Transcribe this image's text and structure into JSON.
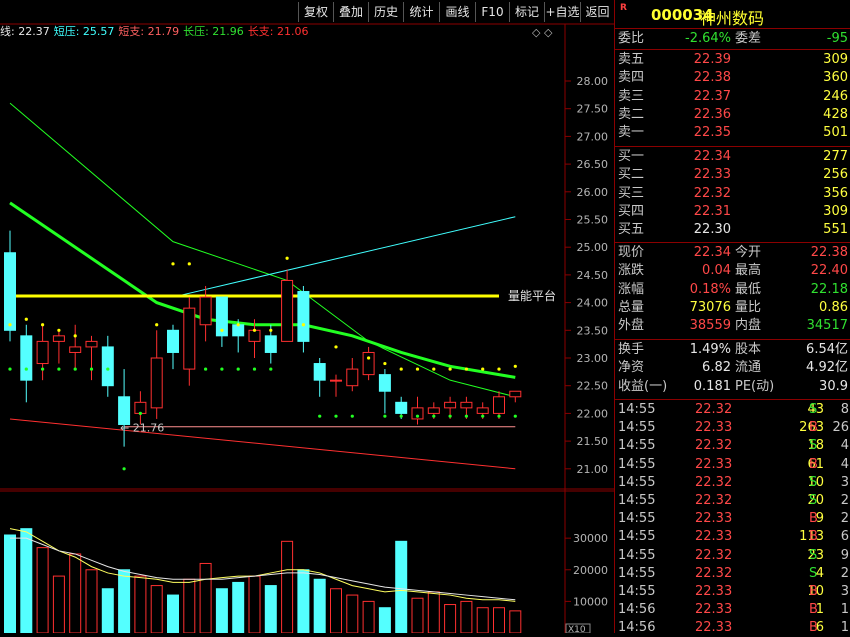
{
  "toolbar": {
    "buttons": [
      "复权",
      "叠加",
      "历史",
      "统计",
      "画线",
      "F10",
      "标记",
      "+自选",
      "返回"
    ]
  },
  "indicators": [
    {
      "label": "线:",
      "value": "22.37",
      "color": "#e6e6e6"
    },
    {
      "label": "短压:",
      "value": "25.57",
      "color": "#40ffff"
    },
    {
      "label": "短支:",
      "value": "21.79",
      "color": "#ff6060"
    },
    {
      "label": "长压:",
      "value": "21.96",
      "color": "#30e030"
    },
    {
      "label": "长支:",
      "value": "21.06",
      "color": "#ff3030"
    }
  ],
  "annotations": {
    "platform_label": "量能平台",
    "low_label": "21.76",
    "vol_unit": "X10",
    "top_marker": "◇ ◇"
  },
  "colors": {
    "up": "#ff3030",
    "down": "#54ffff",
    "ma_green": "#22ff22",
    "platform": "#ffff00",
    "axis": "#8b0000"
  },
  "chart_data": [
    {
      "type": "candlestick",
      "y_ticks": [
        "28.00",
        "27.50",
        "27.00",
        "26.50",
        "26.00",
        "25.50",
        "25.00",
        "24.50",
        "24.00",
        "23.50",
        "23.00",
        "22.50",
        "22.00",
        "21.50",
        "21.00"
      ],
      "ylim": [
        20.55,
        28.55
      ],
      "candles": [
        {
          "o": 24.9,
          "c": 23.5,
          "h": 25.3,
          "l": 23.3
        },
        {
          "o": 23.4,
          "c": 22.6,
          "h": 23.6,
          "l": 22.2
        },
        {
          "o": 22.9,
          "c": 23.3,
          "h": 23.6,
          "l": 22.6
        },
        {
          "o": 23.3,
          "c": 23.4,
          "h": 23.5,
          "l": 22.9
        },
        {
          "o": 23.1,
          "c": 23.2,
          "h": 23.6,
          "l": 22.8
        },
        {
          "o": 23.2,
          "c": 23.3,
          "h": 23.4,
          "l": 22.6
        },
        {
          "o": 23.2,
          "c": 22.5,
          "h": 23.4,
          "l": 22.3
        },
        {
          "o": 22.3,
          "c": 21.8,
          "h": 22.8,
          "l": 21.4
        },
        {
          "o": 22.0,
          "c": 22.2,
          "h": 22.4,
          "l": 21.8
        },
        {
          "o": 22.1,
          "c": 23.0,
          "h": 23.5,
          "l": 21.9
        },
        {
          "o": 23.5,
          "c": 23.1,
          "h": 23.6,
          "l": 22.8
        },
        {
          "o": 22.8,
          "c": 23.9,
          "h": 24.1,
          "l": 22.5
        },
        {
          "o": 23.6,
          "c": 24.1,
          "h": 24.3,
          "l": 23.3
        },
        {
          "o": 24.1,
          "c": 23.4,
          "h": 24.1,
          "l": 23.2
        },
        {
          "o": 23.6,
          "c": 23.4,
          "h": 23.7,
          "l": 23.1
        },
        {
          "o": 23.3,
          "c": 23.5,
          "h": 23.7,
          "l": 23.0
        },
        {
          "o": 23.4,
          "c": 23.1,
          "h": 23.6,
          "l": 22.9
        },
        {
          "o": 23.3,
          "c": 24.4,
          "h": 24.6,
          "l": 23.3
        },
        {
          "o": 24.2,
          "c": 23.3,
          "h": 24.3,
          "l": 23.1
        },
        {
          "o": 22.9,
          "c": 22.6,
          "h": 23.0,
          "l": 22.3
        },
        {
          "o": 22.6,
          "c": 22.6,
          "h": 22.7,
          "l": 22.3
        },
        {
          "o": 22.5,
          "c": 22.8,
          "h": 23.0,
          "l": 22.4
        },
        {
          "o": 22.7,
          "c": 23.1,
          "h": 23.2,
          "l": 22.6
        },
        {
          "o": 22.7,
          "c": 22.4,
          "h": 22.8,
          "l": 22.0
        },
        {
          "o": 22.2,
          "c": 22.0,
          "h": 22.3,
          "l": 21.9
        },
        {
          "o": 21.9,
          "c": 22.1,
          "h": 22.3,
          "l": 21.8
        },
        {
          "o": 22.0,
          "c": 22.1,
          "h": 22.2,
          "l": 21.9
        },
        {
          "o": 22.1,
          "c": 22.2,
          "h": 22.3,
          "l": 21.9
        },
        {
          "o": 22.1,
          "c": 22.2,
          "h": 22.3,
          "l": 21.9
        },
        {
          "o": 22.0,
          "c": 22.1,
          "h": 22.2,
          "l": 21.9
        },
        {
          "o": 22.0,
          "c": 22.3,
          "h": 22.4,
          "l": 21.9
        },
        {
          "o": 22.3,
          "c": 22.4,
          "h": 22.4,
          "l": 22.2
        }
      ],
      "lines": [
        {
          "name": "ma_green",
          "color": "#22ff22",
          "width": 3,
          "points": [
            [
              0,
              25.8
            ],
            [
              3,
              25.2
            ],
            [
              6,
              24.6
            ],
            [
              9,
              24.0
            ],
            [
              12,
              23.7
            ],
            [
              15,
              23.6
            ],
            [
              18,
              23.6
            ],
            [
              21,
              23.4
            ],
            [
              24,
              23.1
            ],
            [
              27,
              22.85
            ],
            [
              30,
              22.7
            ],
            [
              31,
              22.65
            ]
          ]
        },
        {
          "name": "ma_thin_green",
          "color": "#22ff22",
          "width": 1,
          "points": [
            [
              0,
              27.6
            ],
            [
              10,
              25.1
            ],
            [
              17,
              24.4
            ],
            [
              22,
              23.3
            ],
            [
              27,
              22.6
            ],
            [
              31,
              22.3
            ]
          ]
        },
        {
          "name": "cyan_trend",
          "color": "#40ffff",
          "width": 1,
          "points": [
            [
              10,
              24.1
            ],
            [
              31,
              25.55
            ]
          ]
        },
        {
          "name": "red_trend",
          "color": "#ff3030",
          "width": 1,
          "points": [
            [
              0,
              21.9
            ],
            [
              31,
              21.0
            ]
          ]
        },
        {
          "name": "pink_flat",
          "color": "#ff9090",
          "width": 1,
          "points": [
            [
              7,
              21.76
            ],
            [
              31,
              21.76
            ]
          ]
        },
        {
          "name": "platform",
          "color": "#ffff00",
          "width": 3,
          "points": [
            [
              0,
              24.12
            ],
            [
              30,
              24.12
            ]
          ]
        }
      ],
      "dots_yellow": [
        [
          0,
          23.6
        ],
        [
          1,
          23.7
        ],
        [
          2,
          23.6
        ],
        [
          3,
          23.5
        ],
        [
          4,
          23.4
        ],
        [
          9,
          23.6
        ],
        [
          10,
          24.7
        ],
        [
          11,
          24.7
        ],
        [
          13,
          23.5
        ],
        [
          14,
          23.6
        ],
        [
          15,
          23.5
        ],
        [
          16,
          23.5
        ],
        [
          17,
          24.8
        ],
        [
          18,
          23.6
        ],
        [
          20,
          23.2
        ],
        [
          22,
          23.0
        ],
        [
          23,
          22.9
        ],
        [
          24,
          22.8
        ],
        [
          25,
          22.8
        ],
        [
          26,
          22.8
        ],
        [
          27,
          22.8
        ],
        [
          28,
          22.8
        ],
        [
          29,
          22.8
        ],
        [
          30,
          22.8
        ],
        [
          31,
          22.85
        ]
      ],
      "dots_green": [
        [
          0,
          22.8
        ],
        [
          1,
          22.8
        ],
        [
          2,
          22.8
        ],
        [
          3,
          22.8
        ],
        [
          4,
          22.8
        ],
        [
          5,
          22.8
        ],
        [
          6,
          22.8
        ],
        [
          7,
          21.0
        ],
        [
          8,
          22.0
        ],
        [
          12,
          22.8
        ],
        [
          13,
          22.8
        ],
        [
          14,
          22.8
        ],
        [
          15,
          22.8
        ],
        [
          16,
          22.8
        ],
        [
          19,
          21.95
        ],
        [
          20,
          21.95
        ],
        [
          21,
          21.95
        ],
        [
          23,
          21.95
        ],
        [
          24,
          21.95
        ],
        [
          25,
          21.95
        ],
        [
          26,
          21.95
        ],
        [
          27,
          21.95
        ],
        [
          28,
          21.95
        ],
        [
          29,
          21.95
        ],
        [
          30,
          21.95
        ],
        [
          31,
          21.95
        ]
      ]
    },
    {
      "type": "volume",
      "y_ticks": [
        "30000",
        "20000",
        "10000"
      ],
      "ylim": [
        0,
        35000
      ],
      "values": [
        31000,
        33000,
        27000,
        18000,
        25000,
        20000,
        14000,
        20000,
        18000,
        15000,
        12000,
        17000,
        22000,
        14000,
        16000,
        18000,
        15000,
        29000,
        20000,
        17000,
        14000,
        12000,
        10000,
        8000,
        29000,
        11000,
        13000,
        9000,
        10000,
        8000,
        8000,
        7000
      ],
      "ma_yellow": [
        33000,
        32000,
        29000,
        26000,
        24000,
        21000,
        19000,
        18000,
        17500,
        17000,
        16000,
        16000,
        17000,
        17500,
        18000,
        18000,
        19000,
        20000,
        20000,
        19000,
        17000,
        15000,
        14000,
        13000,
        13500,
        13000,
        12500,
        12000,
        11000,
        10500,
        10500,
        10000
      ],
      "ma_white": [
        30000,
        30000,
        28000,
        26000,
        25000,
        23000,
        21000,
        19500,
        18500,
        17500,
        17000,
        17000,
        17000,
        17000,
        17500,
        18000,
        18500,
        19000,
        19000,
        18500,
        17500,
        16500,
        15500,
        14500,
        14000,
        13500,
        13000,
        12500,
        12000,
        11500,
        11000,
        10500
      ]
    }
  ],
  "quote": {
    "header": {
      "r": "R",
      "code": "000034",
      "name": "神州数码"
    },
    "weibi": {
      "l1": "委比",
      "v1": "-2.64%",
      "l2": "委差",
      "v2": "-95"
    },
    "sells": [
      {
        "label": "卖五",
        "price": "22.39",
        "vol": "309"
      },
      {
        "label": "卖四",
        "price": "22.38",
        "vol": "360"
      },
      {
        "label": "卖三",
        "price": "22.37",
        "vol": "246"
      },
      {
        "label": "卖二",
        "price": "22.36",
        "vol": "428"
      },
      {
        "label": "卖一",
        "price": "22.35",
        "vol": "501"
      }
    ],
    "buys": [
      {
        "label": "买一",
        "price": "22.34",
        "vol": "277"
      },
      {
        "label": "买二",
        "price": "22.33",
        "vol": "256"
      },
      {
        "label": "买三",
        "price": "22.32",
        "vol": "356"
      },
      {
        "label": "买四",
        "price": "22.31",
        "vol": "309"
      },
      {
        "label": "买五",
        "price": "22.30",
        "vol": "551"
      }
    ],
    "stats1": [
      {
        "l1": "现价",
        "v1": "22.34",
        "l2": "今开",
        "v2": "22.38"
      },
      {
        "l1": "涨跌",
        "v1": "0.04",
        "l2": "最高",
        "v2": "22.40"
      },
      {
        "l1": "涨幅",
        "v1": "0.18%",
        "l2": "最低",
        "v2": "22.18"
      },
      {
        "l1": "总量",
        "v1": "73076",
        "l2": "量比",
        "v2": "0.86"
      },
      {
        "l1": "外盘",
        "v1": "38559",
        "l2": "内盘",
        "v2": "34517"
      }
    ],
    "stats2": [
      {
        "l1": "换手",
        "v1": "1.49%",
        "l2": "股本",
        "v2": "6.54亿"
      },
      {
        "l1": "净资",
        "v1": "6.82",
        "l2": "流通",
        "v2": "4.92亿"
      },
      {
        "l1": "收益(一)",
        "v1": "0.181",
        "l2": "PE(动)",
        "v2": "30.9"
      }
    ],
    "ticks": [
      {
        "t": "14:55",
        "p": "22.32",
        "v": "43",
        "s": "S",
        "n": "8"
      },
      {
        "t": "14:55",
        "p": "22.33",
        "v": "263",
        "s": "B",
        "n": "26"
      },
      {
        "t": "14:55",
        "p": "22.32",
        "v": "18",
        "s": "S",
        "n": "4"
      },
      {
        "t": "14:55",
        "p": "22.33",
        "v": "61",
        "s": "B",
        "n": "4"
      },
      {
        "t": "14:55",
        "p": "22.32",
        "v": "10",
        "s": "S",
        "n": "3"
      },
      {
        "t": "14:55",
        "p": "22.32",
        "v": "20",
        "s": "S",
        "n": "2"
      },
      {
        "t": "14:55",
        "p": "22.33",
        "v": "9",
        "s": "B",
        "n": "2"
      },
      {
        "t": "14:55",
        "p": "22.33",
        "v": "113",
        "s": "B",
        "n": "6"
      },
      {
        "t": "14:55",
        "p": "22.32",
        "v": "23",
        "s": "S",
        "n": "9"
      },
      {
        "t": "14:55",
        "p": "22.32",
        "v": "4",
        "s": "S",
        "n": "2"
      },
      {
        "t": "14:55",
        "p": "22.33",
        "v": "10",
        "s": "B",
        "n": "3"
      },
      {
        "t": "14:56",
        "p": "22.33",
        "v": "1",
        "s": "B",
        "n": "1"
      },
      {
        "t": "14:56",
        "p": "22.33",
        "v": "6",
        "s": "B",
        "n": "1"
      }
    ]
  }
}
